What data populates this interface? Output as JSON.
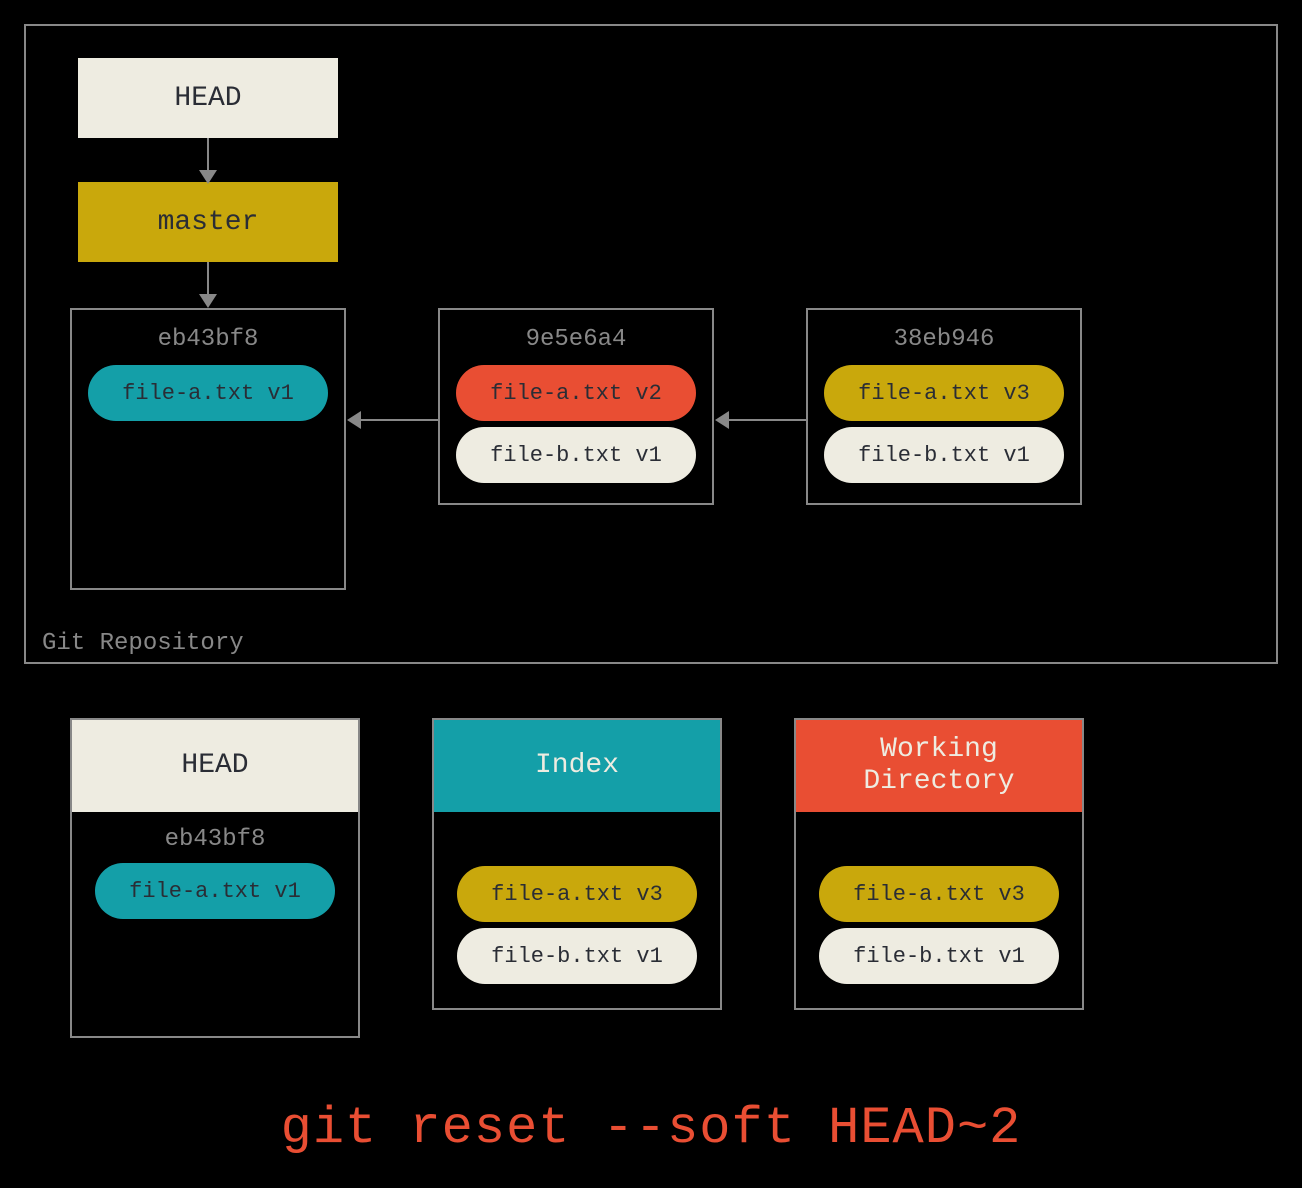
{
  "repo_label": "Git Repository",
  "head_label": "HEAD",
  "master_label": "master",
  "commits": [
    {
      "hash": "eb43bf8",
      "files": [
        {
          "label": "file-a.txt v1",
          "cls": "teal"
        }
      ]
    },
    {
      "hash": "9e5e6a4",
      "files": [
        {
          "label": "file-a.txt v2",
          "cls": "red"
        },
        {
          "label": "file-b.txt v1",
          "cls": "cream"
        }
      ]
    },
    {
      "hash": "38eb946",
      "files": [
        {
          "label": "file-a.txt v3",
          "cls": "yellow"
        },
        {
          "label": "file-b.txt v1",
          "cls": "cream"
        }
      ]
    }
  ],
  "panels": {
    "head": {
      "title": "HEAD",
      "hash": "eb43bf8",
      "files": [
        {
          "label": "file-a.txt v1",
          "cls": "teal"
        }
      ]
    },
    "index": {
      "title": "Index",
      "files": [
        {
          "label": "file-a.txt v3",
          "cls": "yellow"
        },
        {
          "label": "file-b.txt v1",
          "cls": "cream"
        }
      ]
    },
    "wd": {
      "title": "Working Directory",
      "files": [
        {
          "label": "file-a.txt v3",
          "cls": "yellow"
        },
        {
          "label": "file-b.txt v1",
          "cls": "cream"
        }
      ]
    }
  },
  "command": "git reset --soft HEAD~2"
}
